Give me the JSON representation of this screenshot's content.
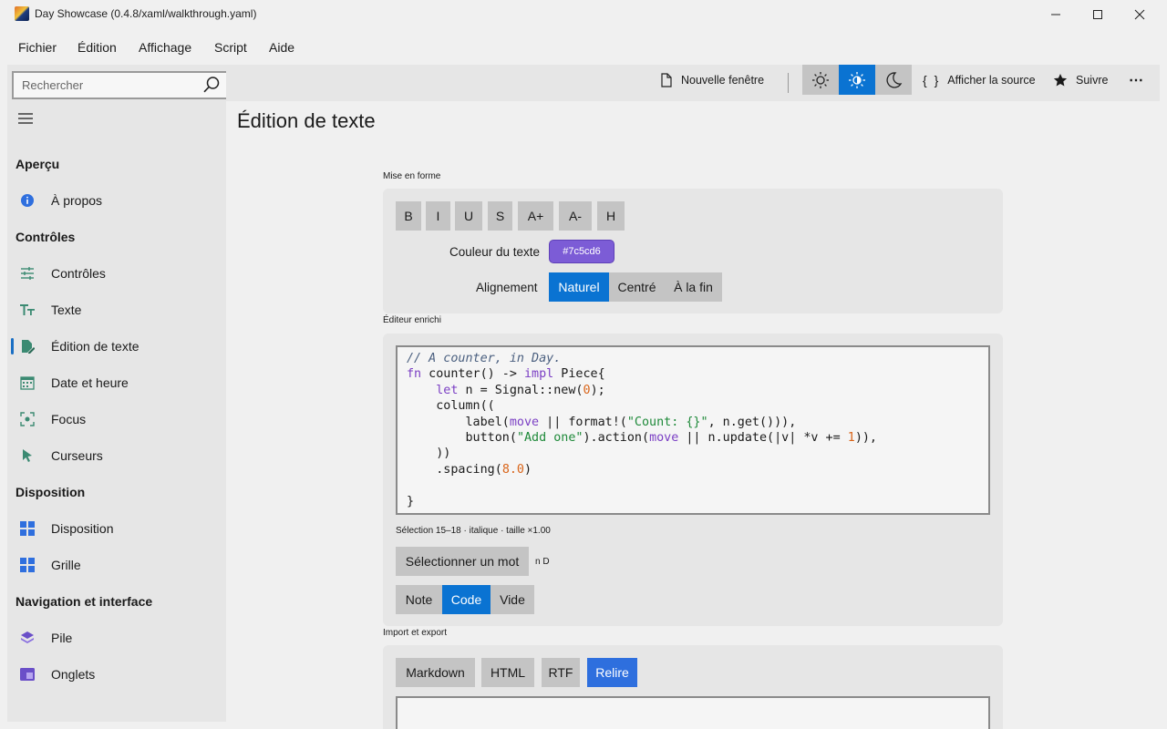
{
  "window": {
    "title": "Day Showcase (0.4.8/xaml/walkthrough.yaml)"
  },
  "menu": [
    "Fichier",
    "Édition",
    "Affichage",
    "Script",
    "Aide"
  ],
  "search": {
    "placeholder": "Rechercher",
    "value": ""
  },
  "sidebar": {
    "sections": [
      {
        "title": "Aperçu",
        "items": [
          {
            "label": "À propos",
            "icon": "info-icon"
          }
        ]
      },
      {
        "title": "Contrôles",
        "items": [
          {
            "label": "Contrôles",
            "icon": "sliders-icon"
          },
          {
            "label": "Texte",
            "icon": "text-size-icon"
          },
          {
            "label": "Édition de texte",
            "icon": "edit-document-icon",
            "active": true
          },
          {
            "label": "Date et heure",
            "icon": "calendar-icon"
          },
          {
            "label": "Focus",
            "icon": "focus-icon"
          },
          {
            "label": "Curseurs",
            "icon": "cursor-icon"
          }
        ]
      },
      {
        "title": "Disposition",
        "items": [
          {
            "label": "Disposition",
            "icon": "layout-icon"
          },
          {
            "label": "Grille",
            "icon": "grid-icon"
          }
        ]
      },
      {
        "title": "Navigation et interface",
        "items": [
          {
            "label": "Pile",
            "icon": "stack-icon"
          },
          {
            "label": "Onglets",
            "icon": "tabs-icon"
          }
        ]
      }
    ]
  },
  "toolbar": {
    "new_window": "Nouvelle fenêtre",
    "show_source": "Afficher la source",
    "source_glyph": "{ }",
    "follow": "Suivre",
    "more": "⋯"
  },
  "page": {
    "title": "Édition de texte",
    "formatting": {
      "label": "Mise en forme",
      "buttons": [
        "B",
        "I",
        "U",
        "S",
        "A+",
        "A-",
        "H"
      ],
      "color_label": "Couleur du texte",
      "color_value": "#7c5cd6",
      "alignment_label": "Alignement",
      "alignment_options": [
        "Naturel",
        "Centré",
        "À la fin"
      ],
      "alignment_selected": "Naturel"
    },
    "rich_editor": {
      "label": "Éditeur enrichi",
      "selection_status": "Sélection 15–18 · italique · taille ×1.00",
      "select_word": "Sélectionner un mot",
      "selection_hint": "n D",
      "modes": [
        "Note",
        "Code",
        "Vide"
      ],
      "mode_selected": "Code"
    },
    "import_export": {
      "label": "Import et export",
      "buttons": [
        "Markdown",
        "HTML",
        "RTF",
        "Relire"
      ]
    }
  }
}
